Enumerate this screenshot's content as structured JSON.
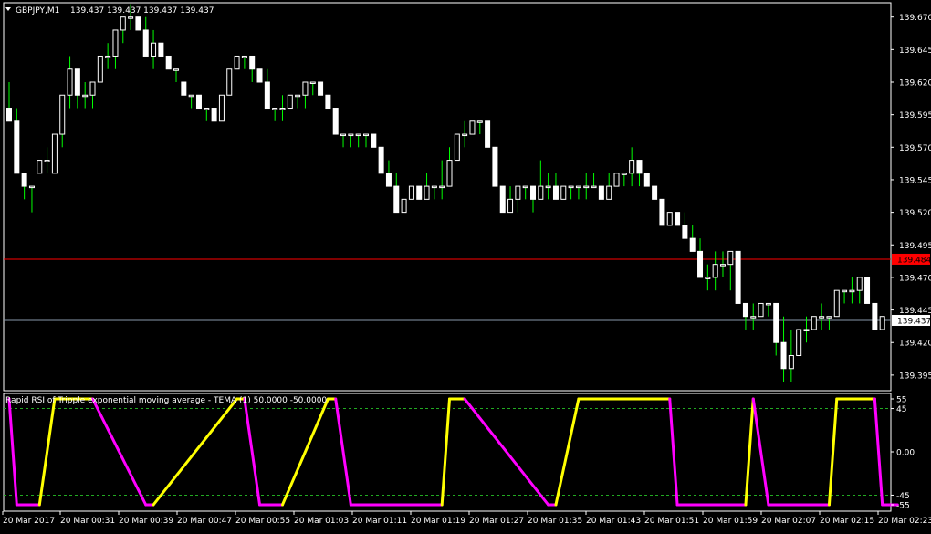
{
  "header": {
    "symbol_text": "GBPJPY,M1",
    "ohlc_text": "139.437 139.437 139.437 139.437"
  },
  "indicator": {
    "title": "Rapid RSI of Tripple exponential moving average - TEMA (1) 50.0000 -50.0000",
    "levels": [
      45,
      -45
    ],
    "scale_labels": [
      "55",
      "45",
      "0.00",
      "-45",
      "-55"
    ]
  },
  "lines": {
    "red_label": "139.484",
    "current_label": "139.437"
  },
  "price_axis": {
    "ticks": [
      "139.670",
      "139.645",
      "139.620",
      "139.595",
      "139.570",
      "139.545",
      "139.520",
      "139.495",
      "139.470",
      "139.445",
      "139.420",
      "139.395"
    ]
  },
  "time_axis": {
    "labels": [
      "20 Mar 2017",
      "20 Mar 00:31",
      "20 Mar 00:39",
      "20 Mar 00:47",
      "20 Mar 00:55",
      "20 Mar 01:03",
      "20 Mar 01:11",
      "20 Mar 01:19",
      "20 Mar 01:27",
      "20 Mar 01:35",
      "20 Mar 01:43",
      "20 Mar 01:51",
      "20 Mar 01:59",
      "20 Mar 02:07",
      "20 Mar 02:15",
      "20 Mar 02:23"
    ]
  },
  "colors": {
    "background": "#000000",
    "bull_candle": "#ffffff",
    "bear_candle": "#ffffff",
    "wick": "#00ff00",
    "grid_text": "#ffffff",
    "red_line": "#ff0000",
    "current_line": "#8899aa",
    "level_line": "#22aa22",
    "rsi_up": "#ffff00",
    "rsi_down": "#ff00ff"
  },
  "chart_data": [
    {
      "type": "candlestick",
      "symbol": "GBPJPY",
      "timeframe": "M1",
      "ylim": [
        139.39,
        139.68
      ],
      "candles": [
        [
          139.6,
          139.62,
          139.59,
          139.59
        ],
        [
          139.59,
          139.6,
          139.55,
          139.55
        ],
        [
          139.55,
          139.55,
          139.53,
          139.54
        ],
        [
          139.54,
          139.54,
          139.52,
          139.54
        ],
        [
          139.55,
          139.56,
          139.55,
          139.56
        ],
        [
          139.56,
          139.57,
          139.55,
          139.56
        ],
        [
          139.55,
          139.58,
          139.55,
          139.58
        ],
        [
          139.58,
          139.61,
          139.57,
          139.61
        ],
        [
          139.61,
          139.64,
          139.6,
          139.63
        ],
        [
          139.63,
          139.63,
          139.6,
          139.61
        ],
        [
          139.61,
          139.62,
          139.6,
          139.61
        ],
        [
          139.61,
          139.62,
          139.6,
          139.62
        ],
        [
          139.62,
          139.64,
          139.62,
          139.64
        ],
        [
          139.64,
          139.65,
          139.63,
          139.64
        ],
        [
          139.64,
          139.66,
          139.63,
          139.66
        ],
        [
          139.66,
          139.67,
          139.65,
          139.67
        ],
        [
          139.67,
          139.68,
          139.66,
          139.67
        ],
        [
          139.67,
          139.67,
          139.66,
          139.66
        ],
        [
          139.66,
          139.67,
          139.64,
          139.64
        ],
        [
          139.64,
          139.66,
          139.63,
          139.65
        ],
        [
          139.65,
          139.65,
          139.64,
          139.64
        ],
        [
          139.64,
          139.64,
          139.63,
          139.63
        ],
        [
          139.63,
          139.63,
          139.62,
          139.63
        ],
        [
          139.62,
          139.62,
          139.61,
          139.61
        ],
        [
          139.61,
          139.61,
          139.6,
          139.61
        ],
        [
          139.61,
          139.61,
          139.6,
          139.6
        ],
        [
          139.6,
          139.6,
          139.59,
          139.6
        ],
        [
          139.6,
          139.6,
          139.59,
          139.59
        ],
        [
          139.59,
          139.61,
          139.59,
          139.61
        ],
        [
          139.61,
          139.63,
          139.61,
          139.63
        ],
        [
          139.63,
          139.64,
          139.63,
          139.64
        ],
        [
          139.64,
          139.64,
          139.63,
          139.64
        ],
        [
          139.64,
          139.64,
          139.62,
          139.63
        ],
        [
          139.63,
          139.63,
          139.62,
          139.62
        ],
        [
          139.62,
          139.63,
          139.6,
          139.6
        ],
        [
          139.6,
          139.6,
          139.59,
          139.6
        ],
        [
          139.6,
          139.61,
          139.59,
          139.6
        ],
        [
          139.6,
          139.61,
          139.6,
          139.61
        ],
        [
          139.61,
          139.61,
          139.6,
          139.61
        ],
        [
          139.61,
          139.62,
          139.6,
          139.62
        ],
        [
          139.62,
          139.62,
          139.61,
          139.62
        ],
        [
          139.62,
          139.62,
          139.61,
          139.61
        ],
        [
          139.61,
          139.61,
          139.6,
          139.6
        ],
        [
          139.6,
          139.6,
          139.58,
          139.58
        ],
        [
          139.58,
          139.58,
          139.57,
          139.58
        ],
        [
          139.58,
          139.58,
          139.57,
          139.58
        ],
        [
          139.58,
          139.58,
          139.57,
          139.58
        ],
        [
          139.58,
          139.58,
          139.57,
          139.58
        ],
        [
          139.58,
          139.58,
          139.57,
          139.57
        ],
        [
          139.57,
          139.57,
          139.55,
          139.55
        ],
        [
          139.55,
          139.56,
          139.54,
          139.54
        ],
        [
          139.54,
          139.55,
          139.52,
          139.52
        ],
        [
          139.52,
          139.53,
          139.52,
          139.53
        ],
        [
          139.53,
          139.54,
          139.53,
          139.54
        ],
        [
          139.54,
          139.54,
          139.53,
          139.53
        ],
        [
          139.53,
          139.55,
          139.53,
          139.54
        ],
        [
          139.54,
          139.54,
          139.53,
          139.54
        ],
        [
          139.54,
          139.56,
          139.53,
          139.54
        ],
        [
          139.54,
          139.57,
          139.54,
          139.56
        ],
        [
          139.56,
          139.58,
          139.56,
          139.58
        ],
        [
          139.58,
          139.59,
          139.57,
          139.58
        ],
        [
          139.58,
          139.59,
          139.58,
          139.59
        ],
        [
          139.59,
          139.59,
          139.58,
          139.59
        ],
        [
          139.59,
          139.59,
          139.57,
          139.57
        ],
        [
          139.57,
          139.57,
          139.54,
          139.54
        ],
        [
          139.54,
          139.54,
          139.52,
          139.52
        ],
        [
          139.52,
          139.54,
          139.52,
          139.53
        ],
        [
          139.53,
          139.54,
          139.52,
          139.54
        ],
        [
          139.54,
          139.54,
          139.53,
          139.54
        ],
        [
          139.54,
          139.54,
          139.52,
          139.53
        ],
        [
          139.53,
          139.56,
          139.53,
          139.54
        ],
        [
          139.54,
          139.55,
          139.53,
          139.54
        ],
        [
          139.54,
          139.55,
          139.53,
          139.53
        ],
        [
          139.53,
          139.54,
          139.53,
          139.54
        ],
        [
          139.54,
          139.54,
          139.53,
          139.54
        ],
        [
          139.54,
          139.54,
          139.53,
          139.54
        ],
        [
          139.54,
          139.55,
          139.53,
          139.54
        ],
        [
          139.54,
          139.55,
          139.54,
          139.54
        ],
        [
          139.54,
          139.54,
          139.53,
          139.53
        ],
        [
          139.53,
          139.55,
          139.53,
          139.54
        ],
        [
          139.54,
          139.55,
          139.54,
          139.55
        ],
        [
          139.55,
          139.55,
          139.54,
          139.55
        ],
        [
          139.55,
          139.57,
          139.54,
          139.56
        ],
        [
          139.56,
          139.56,
          139.54,
          139.55
        ],
        [
          139.55,
          139.55,
          139.54,
          139.54
        ],
        [
          139.54,
          139.54,
          139.53,
          139.53
        ],
        [
          139.53,
          139.53,
          139.51,
          139.51
        ],
        [
          139.51,
          139.52,
          139.51,
          139.52
        ],
        [
          139.52,
          139.52,
          139.51,
          139.51
        ],
        [
          139.51,
          139.52,
          139.5,
          139.5
        ],
        [
          139.5,
          139.51,
          139.49,
          139.49
        ],
        [
          139.49,
          139.5,
          139.47,
          139.47
        ],
        [
          139.47,
          139.48,
          139.46,
          139.47
        ],
        [
          139.47,
          139.49,
          139.46,
          139.48
        ],
        [
          139.48,
          139.49,
          139.47,
          139.48
        ],
        [
          139.48,
          139.49,
          139.46,
          139.49
        ],
        [
          139.49,
          139.49,
          139.45,
          139.45
        ],
        [
          139.45,
          139.45,
          139.43,
          139.44
        ],
        [
          139.44,
          139.45,
          139.43,
          139.44
        ],
        [
          139.44,
          139.45,
          139.44,
          139.45
        ],
        [
          139.45,
          139.45,
          139.44,
          139.45
        ],
        [
          139.45,
          139.45,
          139.41,
          139.42
        ],
        [
          139.42,
          139.44,
          139.39,
          139.4
        ],
        [
          139.4,
          139.43,
          139.39,
          139.41
        ],
        [
          139.41,
          139.43,
          139.41,
          139.43
        ],
        [
          139.43,
          139.44,
          139.42,
          139.43
        ],
        [
          139.43,
          139.44,
          139.43,
          139.44
        ],
        [
          139.44,
          139.45,
          139.43,
          139.44
        ],
        [
          139.44,
          139.44,
          139.43,
          139.44
        ],
        [
          139.44,
          139.46,
          139.44,
          139.46
        ],
        [
          139.46,
          139.46,
          139.45,
          139.46
        ],
        [
          139.46,
          139.47,
          139.45,
          139.46
        ],
        [
          139.46,
          139.47,
          139.45,
          139.47
        ],
        [
          139.47,
          139.47,
          139.45,
          139.45
        ],
        [
          139.45,
          139.45,
          139.43,
          139.43
        ],
        [
          139.43,
          139.44,
          139.43,
          139.44
        ]
      ]
    },
    {
      "type": "line",
      "title": "Rapid RSI of Tripple exponential moving average - TEMA (1) 50.0000 -50.0000",
      "ylim": [
        -55,
        55
      ],
      "x": [
        0,
        1,
        4,
        6,
        11,
        18,
        19,
        30,
        31,
        33,
        36,
        42,
        43,
        45,
        57,
        58,
        60,
        71,
        72,
        75,
        87,
        88,
        97,
        98,
        100,
        108,
        109,
        114,
        115,
        117
      ],
      "values": [
        55,
        -55,
        -55,
        55,
        55,
        -55,
        -55,
        55,
        55,
        -55,
        -55,
        55,
        55,
        -55,
        -55,
        55,
        55,
        -55,
        -55,
        55,
        55,
        -55,
        -55,
        55,
        -55,
        -55,
        55,
        55,
        -55,
        -55
      ],
      "series_colors_by_direction": {
        "rising": "yellow",
        "falling": "magenta"
      }
    }
  ]
}
